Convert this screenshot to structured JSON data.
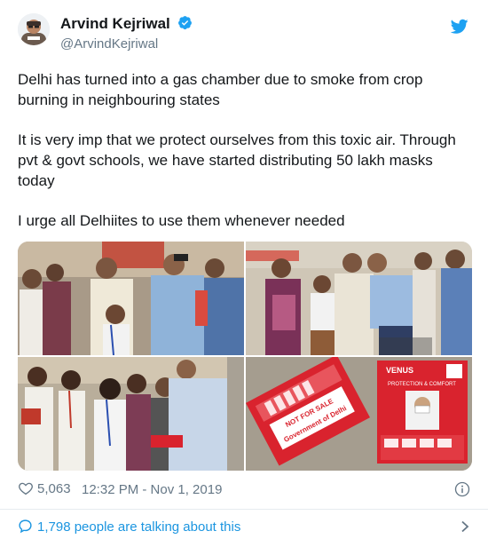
{
  "author": {
    "name": "Arvind Kejriwal",
    "handle": "@ArvindKejriwal",
    "verified": true
  },
  "tweet": {
    "paragraphs": [
      "Delhi has turned into a gas chamber due to smoke from crop burning in neighbouring states",
      "It is very imp that we protect ourselves from this toxic air. Through pvt & govt schools, we have started distributing 50 lakh masks today",
      "I urge all Delhiites to use them whenever needed"
    ]
  },
  "photos": {
    "count": 4,
    "items": [
      {
        "description_icon": "photo",
        "name": "mask-distribution-photo-1"
      },
      {
        "description_icon": "photo",
        "name": "mask-distribution-photo-2"
      },
      {
        "description_icon": "photo",
        "name": "mask-distribution-photo-3"
      },
      {
        "description_icon": "photo",
        "name": "mask-packets-photo"
      }
    ],
    "packet_text": {
      "left_line1": "NOT FOR SALE",
      "left_line2": "Government of Delhi",
      "right_brand": "VENUS",
      "right_line": "PROTECTION & COMFORT"
    }
  },
  "meta": {
    "likes": "5,063",
    "timestamp": "12:32 PM - Nov 1, 2019"
  },
  "conversation": {
    "label": "1,798 people are talking about this"
  },
  "colors": {
    "brand": "#1da1f2",
    "link": "#1b95e0",
    "secondary_text": "#657786",
    "packet_red": "#d9232e"
  },
  "icons": {
    "verified": "verified-badge-icon",
    "bird": "twitter-bird-icon",
    "like": "heart-outline-icon",
    "info": "info-circle-icon",
    "conversation": "speech-bubble-icon",
    "chevron": "chevron-right-icon"
  }
}
